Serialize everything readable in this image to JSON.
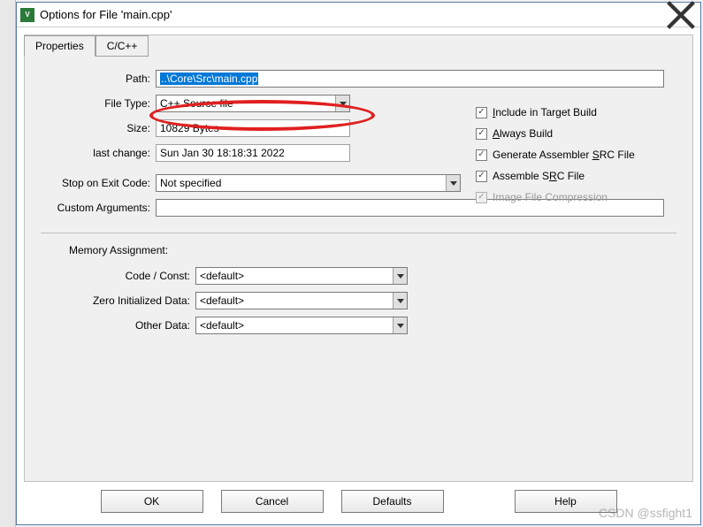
{
  "window": {
    "title": "Options for File 'main.cpp'"
  },
  "tabs": {
    "properties": "Properties",
    "cpp": "C/C++"
  },
  "form": {
    "path_label": "Path:",
    "path_value": "..\\Core\\Src\\main.cpp",
    "filetype_label": "File Type:",
    "filetype_value": "C++ Source file",
    "size_label": "Size:",
    "size_value": "10829 Bytes",
    "lastchange_label": "last change:",
    "lastchange_value": "Sun Jan 30 18:18:31 2022",
    "exitcode_label": "Stop on Exit Code:",
    "exitcode_value": "Not specified",
    "customargs_label": "Custom Arguments:",
    "customargs_value": ""
  },
  "checks": {
    "include_build": "Include in Target Build",
    "always_build": "Always Build",
    "gen_src": "Generate Assembler SRC File",
    "asm_src": "Assemble SRC File",
    "img_compress": "Image File Compression"
  },
  "memory": {
    "title": "Memory Assignment:",
    "code_label": "Code / Const:",
    "code_value": "<default>",
    "zero_label": "Zero Initialized Data:",
    "zero_value": "<default>",
    "other_label": "Other Data:",
    "other_value": "<default>"
  },
  "buttons": {
    "ok": "OK",
    "cancel": "Cancel",
    "defaults": "Defaults",
    "help": "Help"
  },
  "watermark": "CSDN @ssfight1"
}
